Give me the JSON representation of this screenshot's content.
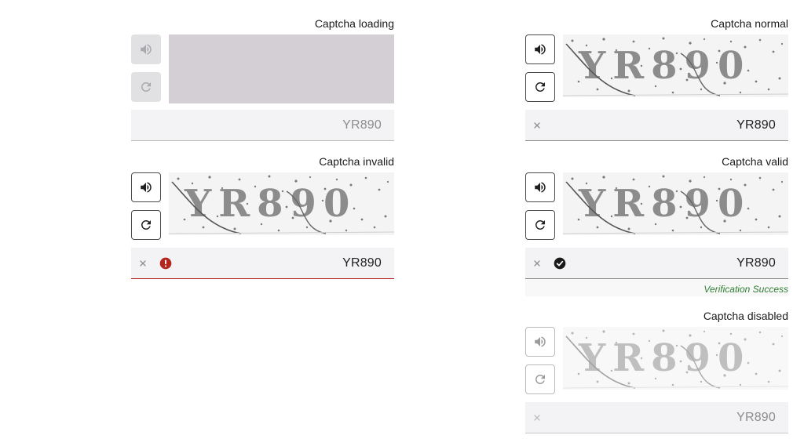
{
  "colors": {
    "border": "#4a4a4a",
    "field_bg": "#f3f2f4",
    "error": "#b3261e",
    "success": "#2e7d32",
    "loading_bg": "#d3cfd4"
  },
  "captcha_text": "YR890",
  "captchas": {
    "loading": {
      "label": "Captcha loading",
      "value": "YR890"
    },
    "normal": {
      "label": "Captcha normal",
      "value": "YR890"
    },
    "invalid": {
      "label": "Captcha invalid",
      "value": "YR890"
    },
    "valid": {
      "label": "Captcha valid",
      "value": "YR890",
      "helper": "Verification Success"
    },
    "disabled": {
      "label": "Captcha disabled",
      "value": "YR890"
    }
  },
  "icons": {
    "audio": "volume-icon",
    "refresh": "refresh-icon",
    "clear": "close-icon",
    "error": "error-icon",
    "success": "check-circle-icon"
  }
}
